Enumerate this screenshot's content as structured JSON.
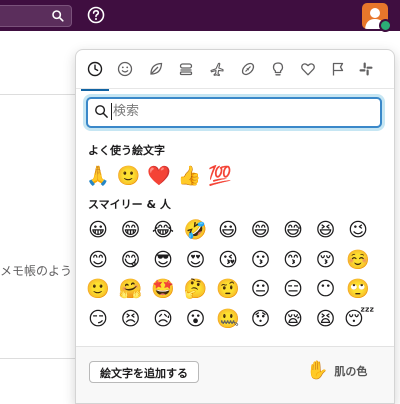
{
  "colors": {
    "topbar": "#3f0e40",
    "accent": "#1264a3",
    "search_border": "#3a88c9",
    "avatar": "#e8762b",
    "presence": "#2bac76"
  },
  "topbar": {
    "search_icon": "search-icon",
    "help_icon": "help-icon",
    "avatar_icon": "user-avatar"
  },
  "background": {
    "text": "メモ帳のよう"
  },
  "picker": {
    "tabs": [
      {
        "name": "recent",
        "icon": "clock-icon"
      },
      {
        "name": "smileys",
        "icon": "smiley-icon"
      },
      {
        "name": "nature",
        "icon": "leaf-icon"
      },
      {
        "name": "food",
        "icon": "food-icon"
      },
      {
        "name": "travel",
        "icon": "airplane-icon"
      },
      {
        "name": "activities",
        "icon": "ball-icon"
      },
      {
        "name": "objects",
        "icon": "lightbulb-icon"
      },
      {
        "name": "symbols",
        "icon": "heart-icon"
      },
      {
        "name": "flags",
        "icon": "flag-icon"
      },
      {
        "name": "custom",
        "icon": "slack-icon"
      }
    ],
    "search": {
      "placeholder": "検索",
      "value": ""
    },
    "frequent_title": "よく使う絵文字",
    "frequent": [
      "🙏",
      "🙂",
      "❤️",
      "👍",
      "💯"
    ],
    "smileys_title": "スマイリー & 人",
    "smileys": [
      [
        "😀",
        "😁",
        "😂",
        "🤣",
        "😃",
        "😄",
        "😅",
        "😆",
        "😉"
      ],
      [
        "😊",
        "😋",
        "😎",
        "😍",
        "😘",
        "😗",
        "😙",
        "😚",
        "☺️"
      ],
      [
        "🙂",
        "🤗",
        "🤩",
        "🤔",
        "🤨",
        "😐",
        "😑",
        "😶",
        "🙄"
      ],
      [
        "😏",
        "😣",
        "😥",
        "😮",
        "🤐",
        "😯",
        "😪",
        "😫",
        "😴"
      ]
    ],
    "footer": {
      "add_button": "絵文字を追加する",
      "skin_emoji": "✋",
      "skin_label": "肌の色"
    }
  }
}
